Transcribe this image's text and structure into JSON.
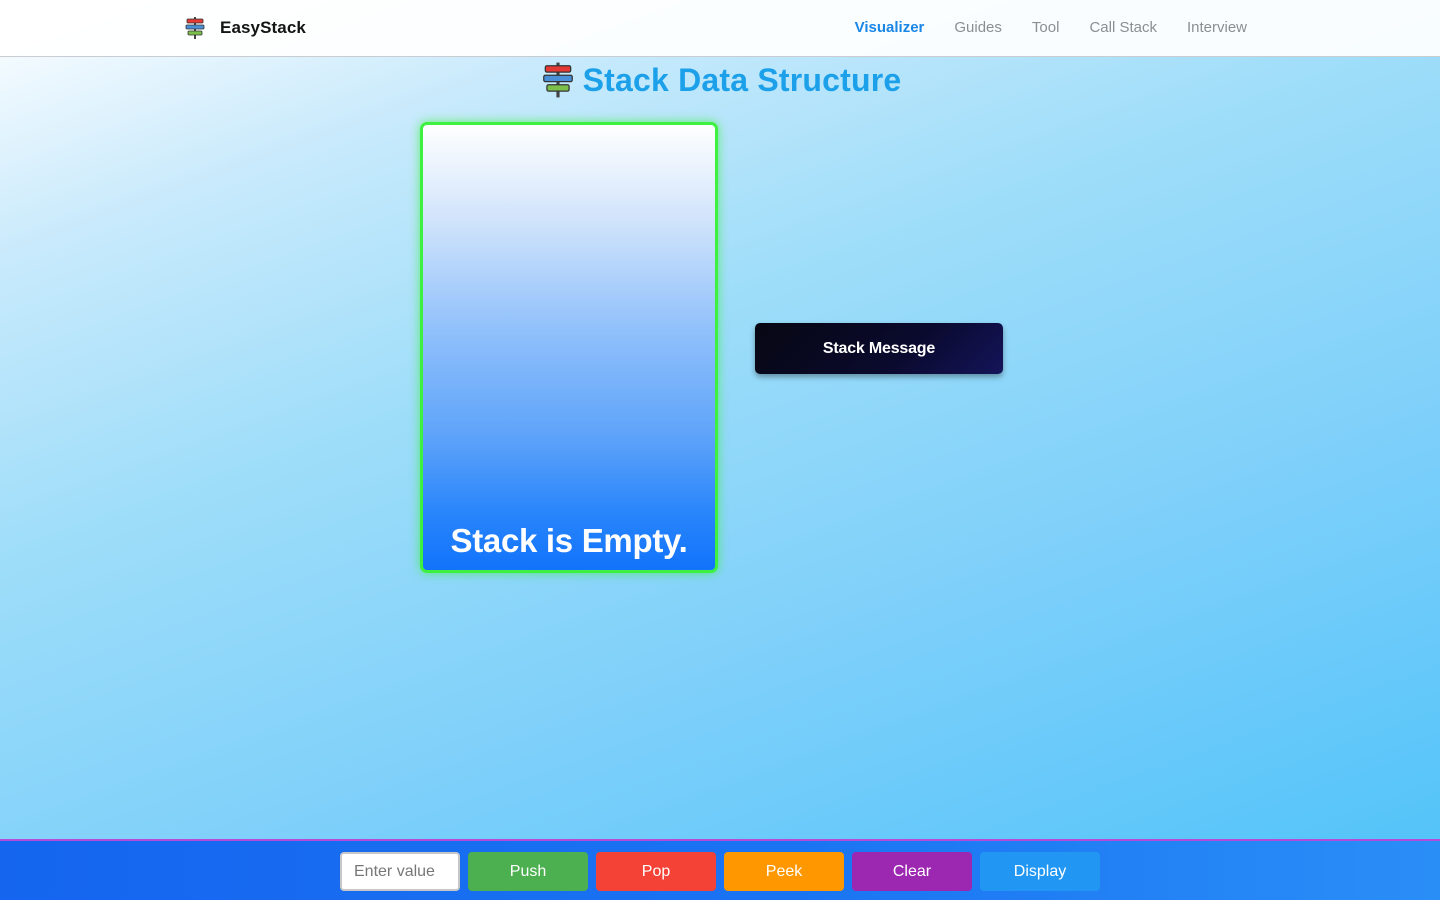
{
  "navbar": {
    "brand": "EasyStack",
    "links": [
      {
        "label": "Visualizer",
        "active": true
      },
      {
        "label": "Guides",
        "active": false
      },
      {
        "label": "Tool",
        "active": false
      },
      {
        "label": "Call Stack",
        "active": false
      },
      {
        "label": "Interview",
        "active": false
      }
    ]
  },
  "header": {
    "title": "Stack Data Structure",
    "icon": "signpost-icon"
  },
  "stack": {
    "status": "Stack is Empty."
  },
  "message": {
    "text": "Stack Message"
  },
  "controls": {
    "input_placeholder": "Enter value",
    "input_value": "",
    "push_label": "Push",
    "pop_label": "Pop",
    "peek_label": "Peek",
    "clear_label": "Clear",
    "display_label": "Display"
  },
  "colors": {
    "accent": "#1a86e6",
    "title": "#1ba0e9",
    "stack_border": "#3ef040",
    "push": "#4caf50",
    "pop": "#f44336",
    "peek": "#ff9800",
    "clear": "#9c27b0",
    "display": "#2196f3"
  }
}
